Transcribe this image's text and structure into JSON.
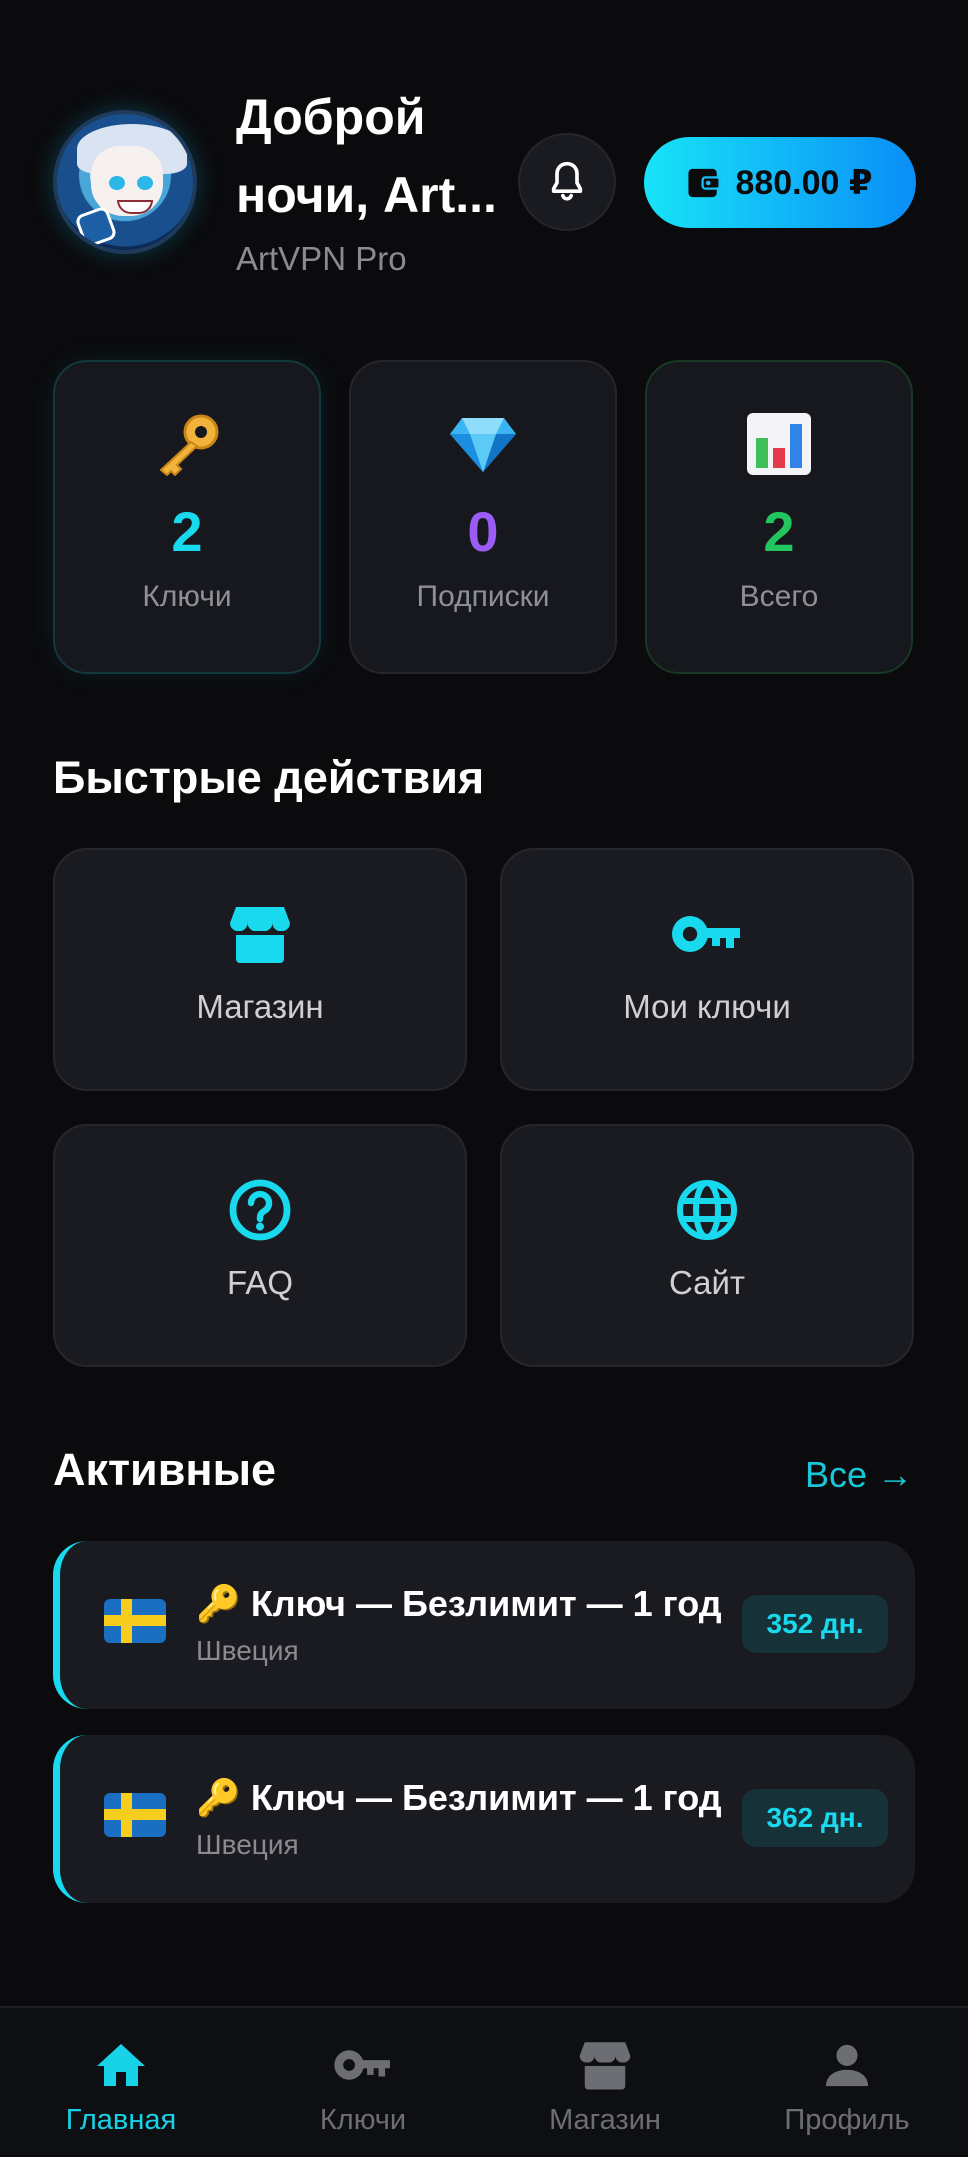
{
  "header": {
    "greeting_line1": "Доброй",
    "greeting_line2": "ночи, Art...",
    "subtitle": "ArtVPN Pro",
    "balance": "880.00 ₽"
  },
  "stats": [
    {
      "value": "2",
      "label": "Ключи",
      "color": "#19d9ee",
      "icon": "key-emoji"
    },
    {
      "value": "0",
      "label": "Подписки",
      "color": "#9b5cf6",
      "icon": "gem-emoji"
    },
    {
      "value": "2",
      "label": "Всего",
      "color": "#22c55e",
      "icon": "bar-chart-emoji"
    }
  ],
  "quick_actions": {
    "title": "Быстрые действия",
    "items": [
      {
        "label": "Магазин",
        "icon": "store-icon"
      },
      {
        "label": "Мои ключи",
        "icon": "key-icon"
      },
      {
        "label": "FAQ",
        "icon": "question-icon"
      },
      {
        "label": "Сайт",
        "icon": "globe-icon"
      }
    ]
  },
  "active": {
    "title": "Активные",
    "all_link": "Все →",
    "items": [
      {
        "title": "🔑 Ключ — Безлимит — 1 год",
        "country": "Швеция",
        "days": "352 дн."
      },
      {
        "title": "🔑 Ключ — Безлимит — 1 год",
        "country": "Швеция",
        "days": "362 дн."
      }
    ]
  },
  "nav": {
    "items": [
      {
        "label": "Главная",
        "icon": "home-icon",
        "active": true
      },
      {
        "label": "Ключи",
        "icon": "key-icon",
        "active": false
      },
      {
        "label": "Магазин",
        "icon": "store-icon",
        "active": false
      },
      {
        "label": "Профиль",
        "icon": "user-icon",
        "active": false
      }
    ]
  },
  "colors": {
    "accent": "#19d9ee",
    "background": "#0b0b0d",
    "card": "#1a1b20"
  }
}
